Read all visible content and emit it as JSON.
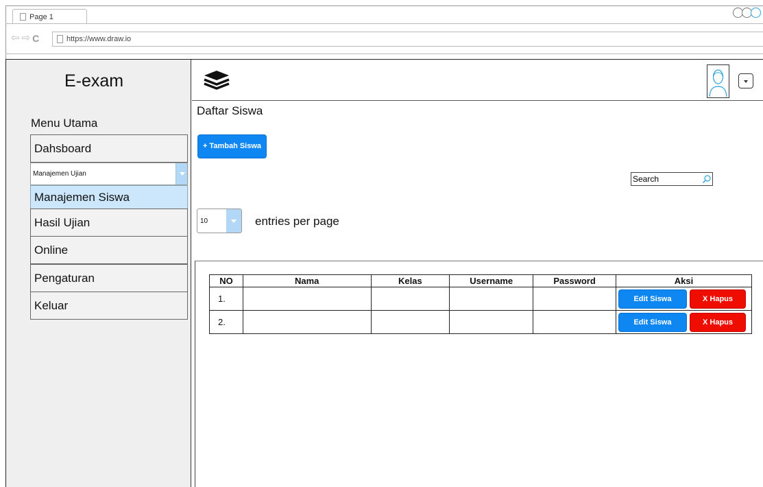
{
  "browser": {
    "tab_title": "Page 1",
    "url": "https://www.draw.io"
  },
  "app": {
    "brand": "E-exam"
  },
  "sidebar": {
    "heading": "Menu Utama",
    "items": [
      {
        "label": "Dahsboard"
      },
      {
        "label": "Manajemen Ujian"
      },
      {
        "label": "Manajemen Siswa"
      },
      {
        "label": "Hasil Ujian"
      },
      {
        "label": "Online"
      },
      {
        "label": "Pengaturan"
      },
      {
        "label": "Keluar"
      }
    ],
    "active_label": "Manajemen Siswa"
  },
  "header": {
    "logo_icon": "layers-icon",
    "avatar_icon": "user-avatar-icon",
    "dropdown_icon": "chevron-down-icon"
  },
  "content": {
    "title": "Daftar Siswa",
    "add_button": "+ Tambah Siswa",
    "search_placeholder": "Search",
    "entries_value": "10",
    "entries_label": "entries per page"
  },
  "table": {
    "columns": [
      "NO",
      "Nama",
      "Kelas",
      "Username",
      "Password",
      "Aksi"
    ],
    "rows": [
      {
        "no": "1.",
        "nama": "",
        "kelas": "",
        "username": "",
        "password": ""
      },
      {
        "no": "2.",
        "nama": "",
        "kelas": "",
        "username": "",
        "password": ""
      }
    ],
    "edit_label": "Edit Siswa",
    "delete_label": "X Hapus"
  },
  "colors": {
    "primary": "#0f87f3",
    "danger": "#ef0c00",
    "active_menu": "#cce6fb",
    "sidebar_bg": "#efefef"
  }
}
